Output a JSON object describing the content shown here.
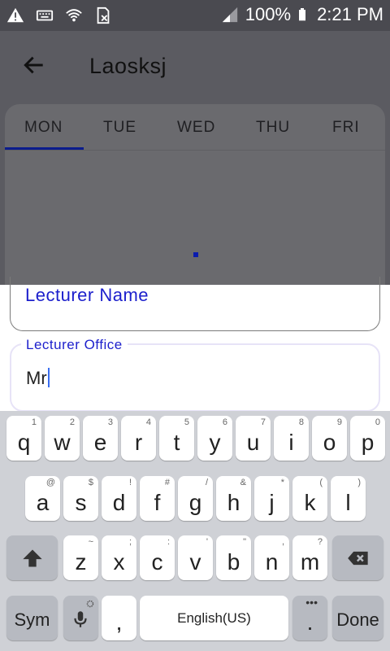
{
  "statusbar": {
    "battery": "100%",
    "time": "2:21 PM",
    "icons": [
      "warning-icon",
      "keyboard-icon",
      "wifi-icon",
      "sim-icon",
      "signal-icon",
      "battery-icon"
    ]
  },
  "appbar": {
    "title": "Laosksj"
  },
  "tabs": [
    "MON",
    "TUE",
    "WED",
    "THU",
    "FRI"
  ],
  "form": {
    "lecturer_name_label": "Lecturer Name",
    "lecturer_office_label": "Lecturer Office",
    "lecturer_office_value": "Mr"
  },
  "keyboard": {
    "row1": [
      {
        "m": "q",
        "h": "1"
      },
      {
        "m": "w",
        "h": "2"
      },
      {
        "m": "e",
        "h": "3"
      },
      {
        "m": "r",
        "h": "4"
      },
      {
        "m": "t",
        "h": "5"
      },
      {
        "m": "y",
        "h": "6"
      },
      {
        "m": "u",
        "h": "7"
      },
      {
        "m": "i",
        "h": "8"
      },
      {
        "m": "o",
        "h": "9"
      },
      {
        "m": "p",
        "h": "0"
      }
    ],
    "row2": [
      {
        "m": "a",
        "h": "@"
      },
      {
        "m": "s",
        "h": "$"
      },
      {
        "m": "d",
        "h": "!"
      },
      {
        "m": "f",
        "h": "#"
      },
      {
        "m": "g",
        "h": "/"
      },
      {
        "m": "h",
        "h": "&"
      },
      {
        "m": "j",
        "h": "*"
      },
      {
        "m": "k",
        "h": "("
      },
      {
        "m": "l",
        "h": ")"
      }
    ],
    "row3": [
      {
        "m": "z",
        "h": "~"
      },
      {
        "m": "x",
        "h": ";"
      },
      {
        "m": "c",
        "h": ":"
      },
      {
        "m": "v",
        "h": "'"
      },
      {
        "m": "b",
        "h": "\""
      },
      {
        "m": "n",
        "h": ","
      },
      {
        "m": "m",
        "h": "?"
      }
    ],
    "sym": "Sym",
    "comma": ",",
    "space": "English(US)",
    "period": ".",
    "done": "Done"
  },
  "colors": {
    "accent": "#1c1fcc",
    "tab_indicator": "#0b1c8c"
  }
}
